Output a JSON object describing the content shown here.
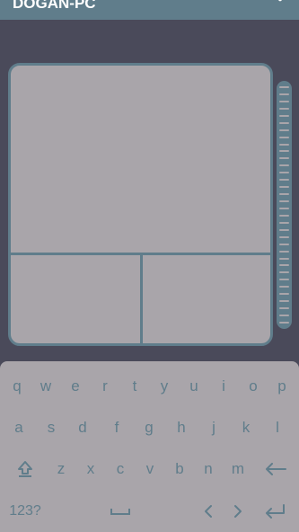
{
  "app": {
    "title": "DOGAN-PC"
  },
  "touchpad": {
    "scroll_strip_lines": 34
  },
  "keyboard": {
    "row1": [
      "q",
      "w",
      "e",
      "r",
      "t",
      "y",
      "u",
      "i",
      "o",
      "p"
    ],
    "row2": [
      "a",
      "s",
      "d",
      "f",
      "g",
      "h",
      "j",
      "k",
      "l"
    ],
    "row3": [
      "z",
      "x",
      "c",
      "v",
      "b",
      "n",
      "m"
    ],
    "symbols_label": "123?"
  },
  "colors": {
    "accent": "#607d8b",
    "surface": "#a9a5aa",
    "background": "#4a4a5a"
  }
}
